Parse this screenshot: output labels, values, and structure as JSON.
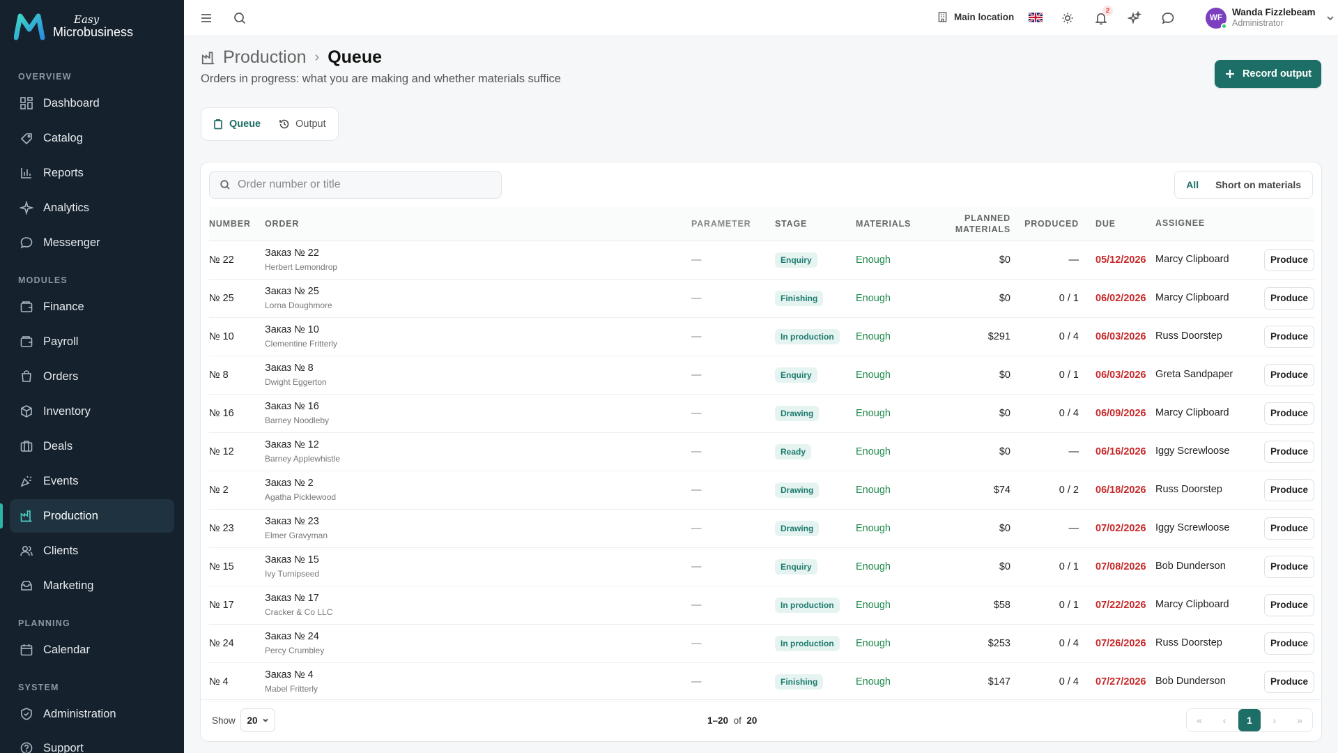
{
  "brand": {
    "easy": "Easy",
    "name": "Microbusiness"
  },
  "sidebar": {
    "sections": [
      {
        "label": "OVERVIEW"
      },
      {
        "label": "MODULES"
      },
      {
        "label": "PLANNING"
      },
      {
        "label": "SYSTEM"
      }
    ],
    "items": [
      {
        "label": "Dashboard",
        "icon": "dashboard-icon"
      },
      {
        "label": "Catalog",
        "icon": "catalog-icon"
      },
      {
        "label": "Reports",
        "icon": "reports-icon"
      },
      {
        "label": "Analytics",
        "icon": "analytics-icon"
      },
      {
        "label": "Messenger",
        "icon": "messenger-icon"
      },
      {
        "label": "Finance",
        "icon": "finance-icon"
      },
      {
        "label": "Payroll",
        "icon": "payroll-icon"
      },
      {
        "label": "Orders",
        "icon": "orders-icon"
      },
      {
        "label": "Inventory",
        "icon": "inventory-icon"
      },
      {
        "label": "Deals",
        "icon": "deals-icon"
      },
      {
        "label": "Events",
        "icon": "events-icon"
      },
      {
        "label": "Production",
        "icon": "production-icon",
        "active": true
      },
      {
        "label": "Clients",
        "icon": "clients-icon"
      },
      {
        "label": "Marketing",
        "icon": "marketing-icon"
      },
      {
        "label": "Calendar",
        "icon": "calendar-icon"
      },
      {
        "label": "Administration",
        "icon": "shield-icon"
      },
      {
        "label": "Support",
        "icon": "help-icon"
      }
    ]
  },
  "topbar": {
    "location": "Main location",
    "notifications_count": "2",
    "user": {
      "initials": "WF",
      "name": "Wanda Fizzlebeam",
      "role": "Administrator"
    }
  },
  "header": {
    "breadcrumb_parent": "Production",
    "breadcrumb_current": "Queue",
    "subtitle": "Orders in progress: what you are making and whether materials suffice",
    "record_button": "Record output"
  },
  "tabs": [
    {
      "label": "Queue",
      "active": true
    },
    {
      "label": "Output",
      "active": false
    }
  ],
  "search": {
    "placeholder": "Order number or title",
    "value": ""
  },
  "filter": {
    "all": "All",
    "short": "Short on materials",
    "selected": "All"
  },
  "table": {
    "headers": {
      "number": "NUMBER",
      "order": "ORDER",
      "parameter": "PARAMETER",
      "stage": "STAGE",
      "materials": "MATERIALS",
      "planned_1": "PLANNED",
      "planned_2": "MATERIALS",
      "produced": "PRODUCED",
      "due": "DUE",
      "assignee": "ASSIGNEE"
    },
    "action_label": "Produce",
    "rows": [
      {
        "number": "№ 22",
        "title": "Заказ № 22",
        "client": "Herbert Lemondrop",
        "parameter": "—",
        "stage": "Enquiry",
        "materials": "Enough",
        "planned": "$0",
        "produced": "—",
        "due": "05/12/2026",
        "assignee": "Marcy Clipboard"
      },
      {
        "number": "№ 25",
        "title": "Заказ № 25",
        "client": "Lorna Doughmore",
        "parameter": "—",
        "stage": "Finishing",
        "materials": "Enough",
        "planned": "$0",
        "produced": "0 / 1",
        "due": "06/02/2026",
        "assignee": "Marcy Clipboard"
      },
      {
        "number": "№ 10",
        "title": "Заказ № 10",
        "client": "Clementine Fritterly",
        "parameter": "—",
        "stage": "In production",
        "materials": "Enough",
        "planned": "$291",
        "produced": "0 / 4",
        "due": "06/03/2026",
        "assignee": "Russ Doorstep"
      },
      {
        "number": "№ 8",
        "title": "Заказ № 8",
        "client": "Dwight Eggerton",
        "parameter": "—",
        "stage": "Enquiry",
        "materials": "Enough",
        "planned": "$0",
        "produced": "0 / 1",
        "due": "06/03/2026",
        "assignee": "Greta Sandpaper"
      },
      {
        "number": "№ 16",
        "title": "Заказ № 16",
        "client": "Barney Noodleby",
        "parameter": "—",
        "stage": "Drawing",
        "materials": "Enough",
        "planned": "$0",
        "produced": "0 / 4",
        "due": "06/09/2026",
        "assignee": "Marcy Clipboard"
      },
      {
        "number": "№ 12",
        "title": "Заказ № 12",
        "client": "Barney Applewhistle",
        "parameter": "—",
        "stage": "Ready",
        "materials": "Enough",
        "planned": "$0",
        "produced": "—",
        "due": "06/16/2026",
        "assignee": "Iggy Screwloose"
      },
      {
        "number": "№ 2",
        "title": "Заказ № 2",
        "client": "Agatha Picklewood",
        "parameter": "—",
        "stage": "Drawing",
        "materials": "Enough",
        "planned": "$74",
        "produced": "0 / 2",
        "due": "06/18/2026",
        "assignee": "Russ Doorstep"
      },
      {
        "number": "№ 23",
        "title": "Заказ № 23",
        "client": "Elmer Gravyman",
        "parameter": "—",
        "stage": "Drawing",
        "materials": "Enough",
        "planned": "$0",
        "produced": "—",
        "due": "07/02/2026",
        "assignee": "Iggy Screwloose"
      },
      {
        "number": "№ 15",
        "title": "Заказ № 15",
        "client": "Ivy Turnipseed",
        "parameter": "—",
        "stage": "Enquiry",
        "materials": "Enough",
        "planned": "$0",
        "produced": "0 / 1",
        "due": "07/08/2026",
        "assignee": "Bob Dunderson"
      },
      {
        "number": "№ 17",
        "title": "Заказ № 17",
        "client": "Cracker & Co LLC",
        "parameter": "—",
        "stage": "In production",
        "materials": "Enough",
        "planned": "$58",
        "produced": "0 / 1",
        "due": "07/22/2026",
        "assignee": "Marcy Clipboard"
      },
      {
        "number": "№ 24",
        "title": "Заказ № 24",
        "client": "Percy Crumbley",
        "parameter": "—",
        "stage": "In production",
        "materials": "Enough",
        "planned": "$253",
        "produced": "0 / 4",
        "due": "07/26/2026",
        "assignee": "Russ Doorstep"
      },
      {
        "number": "№ 4",
        "title": "Заказ № 4",
        "client": "Mabel Fritterly",
        "parameter": "—",
        "stage": "Finishing",
        "materials": "Enough",
        "planned": "$147",
        "produced": "0 / 4",
        "due": "07/27/2026",
        "assignee": "Bob Dunderson"
      }
    ]
  },
  "footer": {
    "show_label": "Show",
    "page_size": "20",
    "range": "1–20",
    "of": "of",
    "total": "20",
    "current_page": "1"
  },
  "colors": {
    "accent": "#1d6e66",
    "sidebar_bg": "#15212c",
    "due": "#c62828",
    "enough": "#1f8a4c"
  }
}
